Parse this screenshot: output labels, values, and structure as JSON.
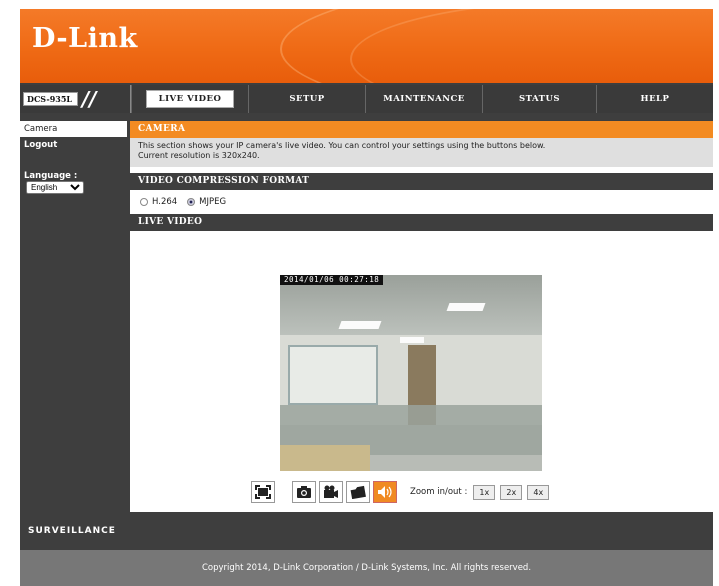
{
  "header": {
    "logo_text": "D-Link",
    "model": "DCS-935L"
  },
  "nav": {
    "tabs": [
      {
        "label": "LIVE VIDEO",
        "active": true
      },
      {
        "label": "SETUP"
      },
      {
        "label": "MAINTENANCE"
      },
      {
        "label": "STATUS"
      },
      {
        "label": "HELP"
      }
    ]
  },
  "sidebar": {
    "items": [
      {
        "label": "Camera",
        "selected": true
      },
      {
        "label": "Logout"
      }
    ],
    "language_label": "Language :",
    "language_value": "English"
  },
  "main": {
    "camera_title": "CAMERA",
    "camera_desc_line1": "This section shows your IP camera's live video. You can control your settings using the buttons below.",
    "camera_desc_line2": "Current resolution is 320x240.",
    "compression_title": "VIDEO COMPRESSION FORMAT",
    "format_h264": "H.264",
    "format_mjpeg": "MJPEG",
    "format_selected": "MJPEG",
    "live_title": "LIVE VIDEO",
    "timestamp": "2014/01/06 00:27:18",
    "zoom_label": "Zoom in/out :",
    "zoom_options": [
      "1x",
      "2x",
      "4x"
    ]
  },
  "footer": {
    "brand": "SURVEILLANCE",
    "copyright": "Copyright 2014, D-Link Corporation / D-Link Systems, Inc. All rights reserved."
  },
  "colors": {
    "brand_orange": "#f38b22",
    "dark_bar": "#3e3e3e"
  }
}
